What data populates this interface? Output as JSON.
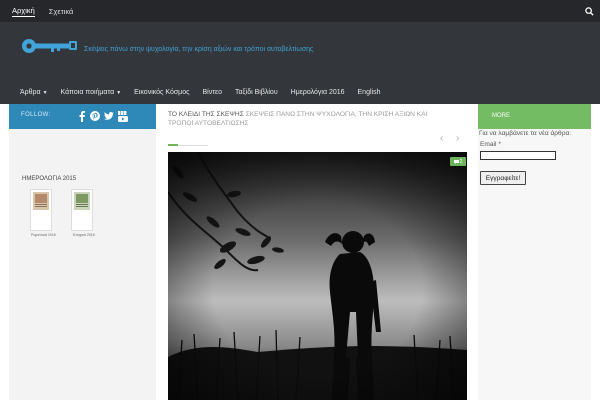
{
  "topnav": {
    "items": [
      "Αρχική",
      "Σχετικά"
    ]
  },
  "header": {
    "tagline": "Σκέψεις πάνω στην ψυχολογία, την κρίση αξιών και τρόποι αυτοβελτίωσης"
  },
  "mainnav": {
    "items": [
      {
        "label": "Άρθρα",
        "has_dropdown": true
      },
      {
        "label": "Κάποια ποιήματα",
        "has_dropdown": true
      },
      {
        "label": "Εικονικός Κόσμος",
        "has_dropdown": false
      },
      {
        "label": "Βίντεο",
        "has_dropdown": false
      },
      {
        "label": "Ταξίδι Βιβλίου",
        "has_dropdown": false
      },
      {
        "label": "Ημερολόγια 2016",
        "has_dropdown": false
      },
      {
        "label": "English",
        "has_dropdown": false
      }
    ],
    "caret": "▼"
  },
  "sidebar_left": {
    "follow_label": "FOLLOW:",
    "social_icons": [
      "facebook-icon",
      "pinterest-icon",
      "twitter-icon",
      "youtube-icon"
    ],
    "widget_title": "ΗΜΕΡΟΛΟΓΙΑ 2015",
    "calendars": [
      {
        "caption": "Ρομαντικά 2016"
      },
      {
        "caption": "Εποχικά 2016"
      }
    ]
  },
  "content": {
    "breadcrumb_home": "ΤΟ ΚΛΕΙΔΙ ΤΗΣ ΣΚΕΨΗΣ",
    "breadcrumb_tagline": "ΣΚΕΨΕΙΣ ΠΑΝΩ ΣΤΗΝ ΨΥΧΟΛΟΓΙΑ, ΤΗΝ ΚΡΙΣΗ ΑΞΙΩΝ ΚΑΙ ΤΡΟΠΟΙ ΑΥΤΟΒΕΛΤΙΩΣΗΣ",
    "prev_arrow": "‹",
    "next_arrow": "›",
    "comment_count": "2"
  },
  "sidebar_right": {
    "more_label": "MORE",
    "newsletter_question": "Για να λαμβάνετε τα νέα άρθρα:",
    "email_label": "Email *",
    "subscribe_button": "Εγγραφείτε!"
  },
  "colors": {
    "topbar": "#26272b",
    "header": "#33363b",
    "tagline": "#41a3d8",
    "follow_bar": "#2f89b8",
    "more_bar": "#74bc63",
    "accent_green": "#6fb55a"
  }
}
